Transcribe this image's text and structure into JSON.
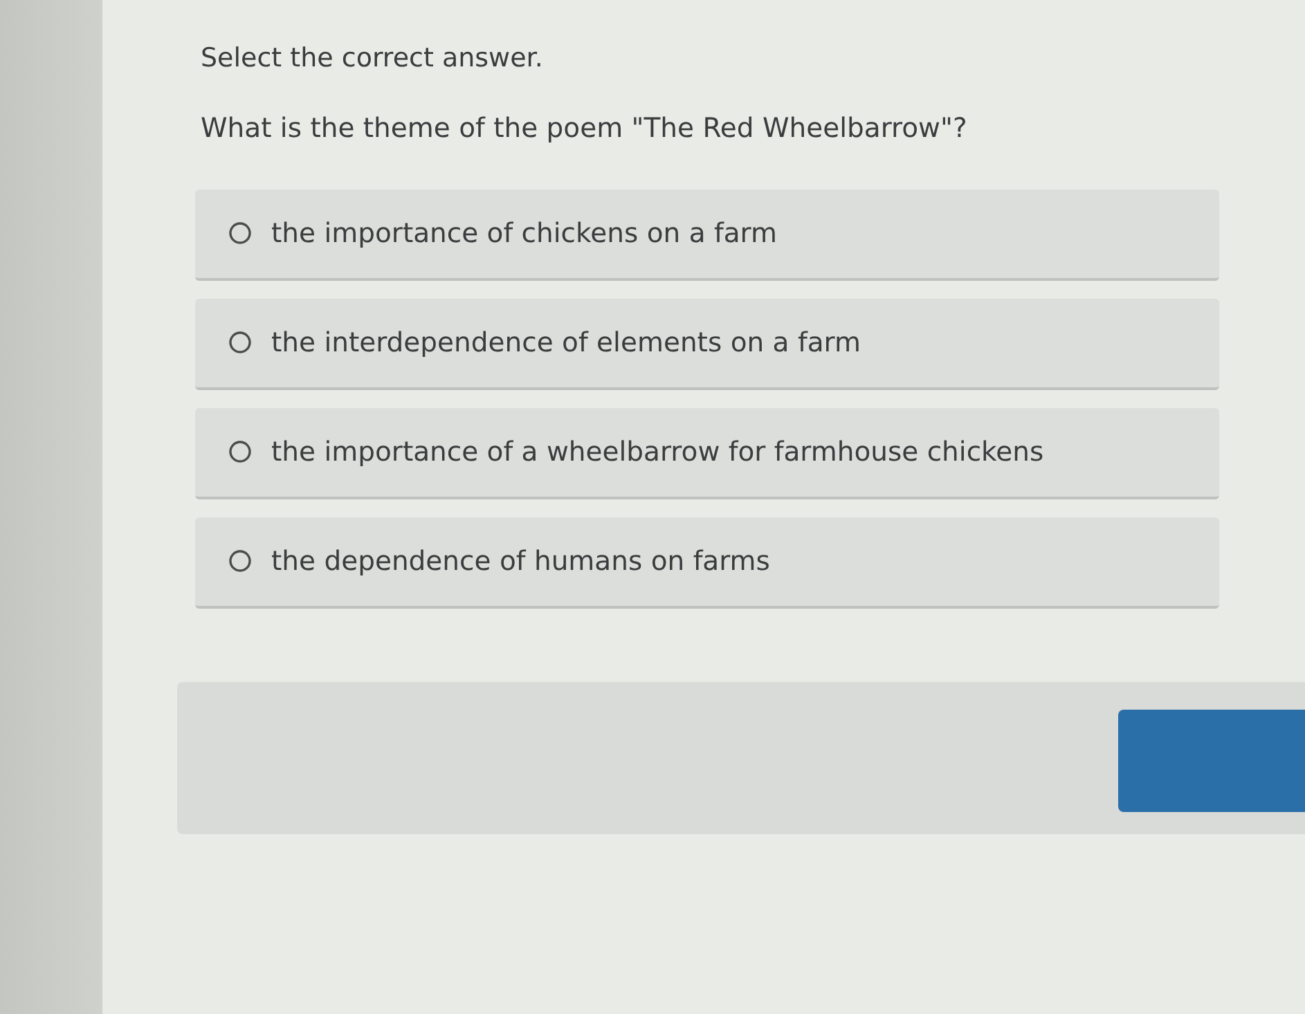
{
  "instruction": "Select the correct answer.",
  "question": "What is the theme of the poem \"The Red Wheelbarrow\"?",
  "options": [
    {
      "label": "the importance of chickens on a farm",
      "selected": false
    },
    {
      "label": "the interdependence of elements on a farm",
      "selected": false
    },
    {
      "label": "the importance of a wheelbarrow for farmhouse chickens",
      "selected": false
    },
    {
      "label": "the dependence of humans on farms",
      "selected": false
    }
  ]
}
